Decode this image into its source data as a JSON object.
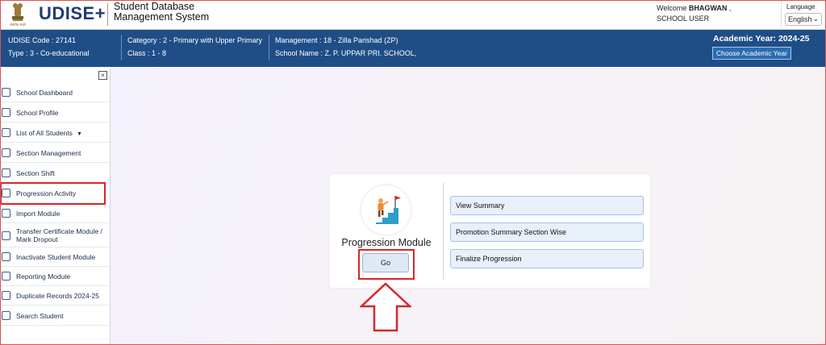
{
  "header": {
    "logo_text": "UDISE",
    "logo_plus": "+",
    "emblem_caption": "सत्यमेव जयते",
    "system_name_line1": "Student Database",
    "system_name_line2": "Management System",
    "welcome_prefix": "Welcome",
    "user_name": "BHAGWAN",
    "user_role": "SCHOOL USER",
    "language_label": "Language",
    "language_selected": "English"
  },
  "infobar": {
    "udise_code": "UDISE Code : 27141",
    "type": "Type : 3 - Co-educational",
    "category": "Category : 2 - Primary with Upper Primary",
    "class": "Class : 1 - 8",
    "management": "Management : 18 - Zilla Parishad (ZP)",
    "school_name": "School Name : Z. P. UPPAR PRI. SCHOOL,",
    "academic_year": "Academic Year: 2024-25",
    "choose_year_button": "Choose Academic Year"
  },
  "sidebar": {
    "close_symbol": "×",
    "items": [
      {
        "label": "School Dashboard",
        "icon": "dashboard-icon"
      },
      {
        "label": "School Profile",
        "icon": "profile-icon"
      },
      {
        "label": "List of All Students",
        "icon": "list-icon",
        "caret": "▼"
      },
      {
        "label": "Section Management",
        "icon": "gear-icon"
      },
      {
        "label": "Section Shift",
        "icon": "users-icon"
      },
      {
        "label": "Progression Activity",
        "icon": "progression-icon"
      },
      {
        "label": "Import Module",
        "icon": "import-icon"
      },
      {
        "label": "Transfer Certificate Module / Mark Dropout",
        "icon": "certificate-icon"
      },
      {
        "label": "Inactivate Student Module",
        "icon": "user-icon"
      },
      {
        "label": "Reporting Module",
        "icon": "report-icon"
      },
      {
        "label": "Duplicate Records 2024-25",
        "icon": "duplicate-icon"
      },
      {
        "label": "Search Student",
        "icon": "search-icon"
      }
    ]
  },
  "module": {
    "title": "Progression Module",
    "go_button": "Go",
    "options": [
      "View Summary",
      "Promotion Summary Section Wise",
      "Finalize Progression"
    ]
  },
  "colors": {
    "brand_blue": "#1f4e87",
    "highlight_red": "#d9252a",
    "button_light_blue": "#e8f0fa"
  }
}
